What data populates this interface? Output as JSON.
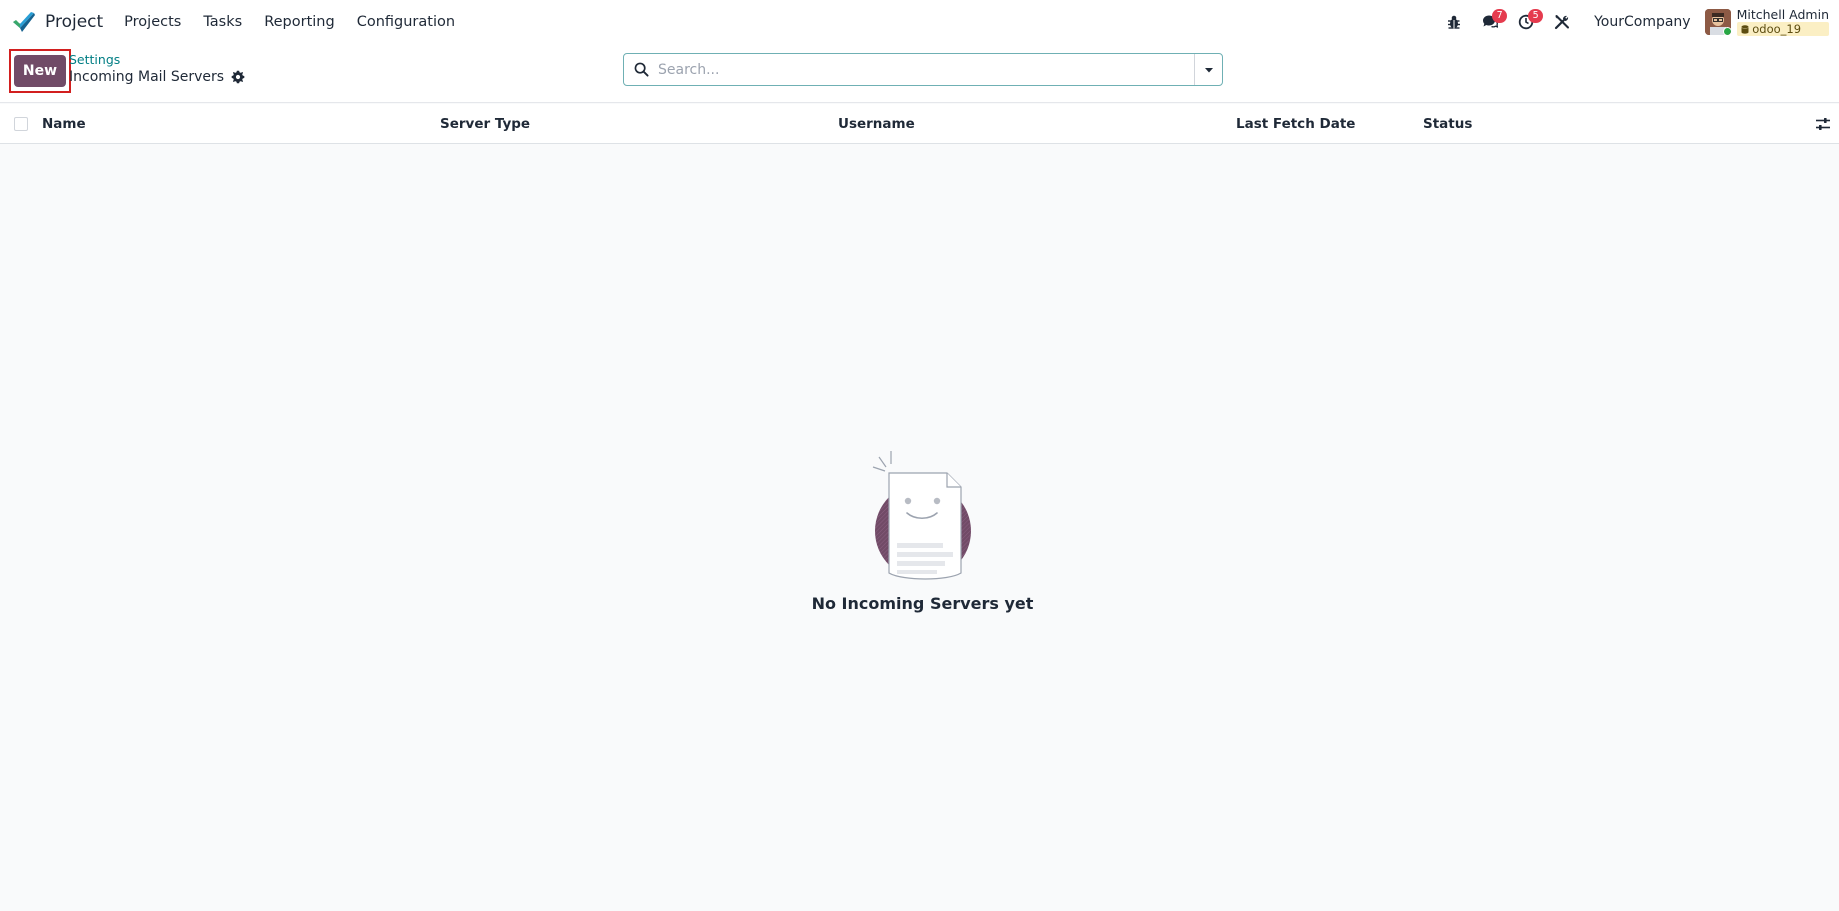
{
  "app": {
    "brand_name": "Project",
    "brand_icon": "checkmark-logo"
  },
  "menu": [
    {
      "label": "Projects"
    },
    {
      "label": "Tasks"
    },
    {
      "label": "Reporting"
    },
    {
      "label": "Configuration"
    }
  ],
  "systray": {
    "debug_icon": "bug-icon",
    "messages_icon": "chat-icon",
    "messages_count": "7",
    "activities_icon": "clock-icon",
    "activities_count": "5",
    "tools_icon": "tools-icon",
    "company": "YourCompany",
    "user_name": "Mitchell Admin",
    "database": "odoo_19"
  },
  "control_panel": {
    "new_label": "New",
    "breadcrumb_parent": "Settings",
    "breadcrumb_current": "Incoming Mail Servers",
    "search_placeholder": "Search..."
  },
  "list": {
    "columns": [
      {
        "label": "Name"
      },
      {
        "label": "Server Type"
      },
      {
        "label": "Username"
      },
      {
        "label": "Last Fetch Date"
      },
      {
        "label": "Status"
      }
    ]
  },
  "empty_state": {
    "title": "No Incoming Servers yet"
  },
  "colors": {
    "primary": "#714b67",
    "link": "#017e84",
    "badge": "#e53b4e",
    "highlight_border": "#d21f1f"
  }
}
